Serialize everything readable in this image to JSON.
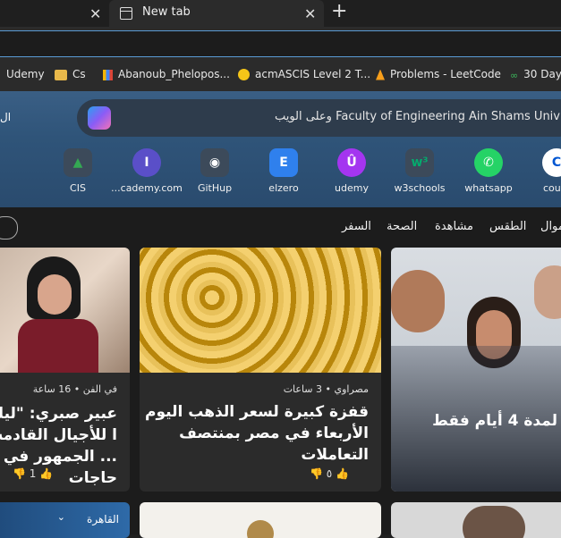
{
  "tabs": {
    "prev_close": "✕",
    "active_title": "New tab",
    "active_close": "✕",
    "new_tab": "+"
  },
  "bookmarks": [
    {
      "label": "Udemy",
      "icon": "udemy-icon"
    },
    {
      "label": "Cs",
      "icon": "folder-icon"
    },
    {
      "label": "Abanoub_Phelopos...",
      "icon": "bar-chart-icon"
    },
    {
      "label": "acmASCIS Level 2 T...",
      "icon": "emoji-icon"
    },
    {
      "label": "Problems - LeetCode",
      "icon": "leetcode-icon"
    },
    {
      "label": "30 Day",
      "icon": "green-icon"
    }
  ],
  "search": {
    "text": "Faculty of Engineering Ain Shams Univ وعلى الويب",
    "left_edge": "ال"
  },
  "shortcuts": [
    {
      "label": "CIS",
      "icon": "google-drive-icon",
      "glyph": "▲",
      "color": "#34a853"
    },
    {
      "label": "...cademy.com",
      "icon": "academy-icon",
      "glyph": "I",
      "color": "#6b5bd6"
    },
    {
      "label": "GitHup",
      "icon": "github-icon",
      "glyph": "◉",
      "color": "#ffffff"
    },
    {
      "label": "elzero",
      "icon": "elzero-icon",
      "glyph": "E",
      "color": "#2f80ed"
    },
    {
      "label": "udemy",
      "icon": "udemy-icon",
      "glyph": "Û",
      "color": "#a435f0"
    },
    {
      "label": "w3schools",
      "icon": "w3schools-icon",
      "glyph": "w³",
      "color": "#04aa6d"
    },
    {
      "label": "whatsapp",
      "icon": "whatsapp-icon",
      "glyph": "✆",
      "color": "#25d366"
    },
    {
      "label": "cours",
      "icon": "coursera-icon",
      "glyph": "C",
      "color": "#0056d2"
    }
  ],
  "categories": [
    "السفر",
    "الصحة",
    "مشاهدة",
    "الطقس",
    "موال"
  ],
  "cards": [
    {
      "source": "في الفن • 16 ساعة",
      "headline": "عبير صبري: \"ليلة ا للأجيال القادمة ... الجمهور في حاجات",
      "reactions": "1"
    },
    {
      "source": "مصراوي • 3 ساعات",
      "headline": "قفزة كبيرة لسعر الذهب اليوم الأربعاء في مصر بمنتصف التعاملات",
      "reactions": "٥"
    },
    {
      "source": "",
      "headline": "لمدة 4 أيام فقط",
      "reactions": ""
    }
  ],
  "weather": {
    "city": "القاهرة"
  }
}
